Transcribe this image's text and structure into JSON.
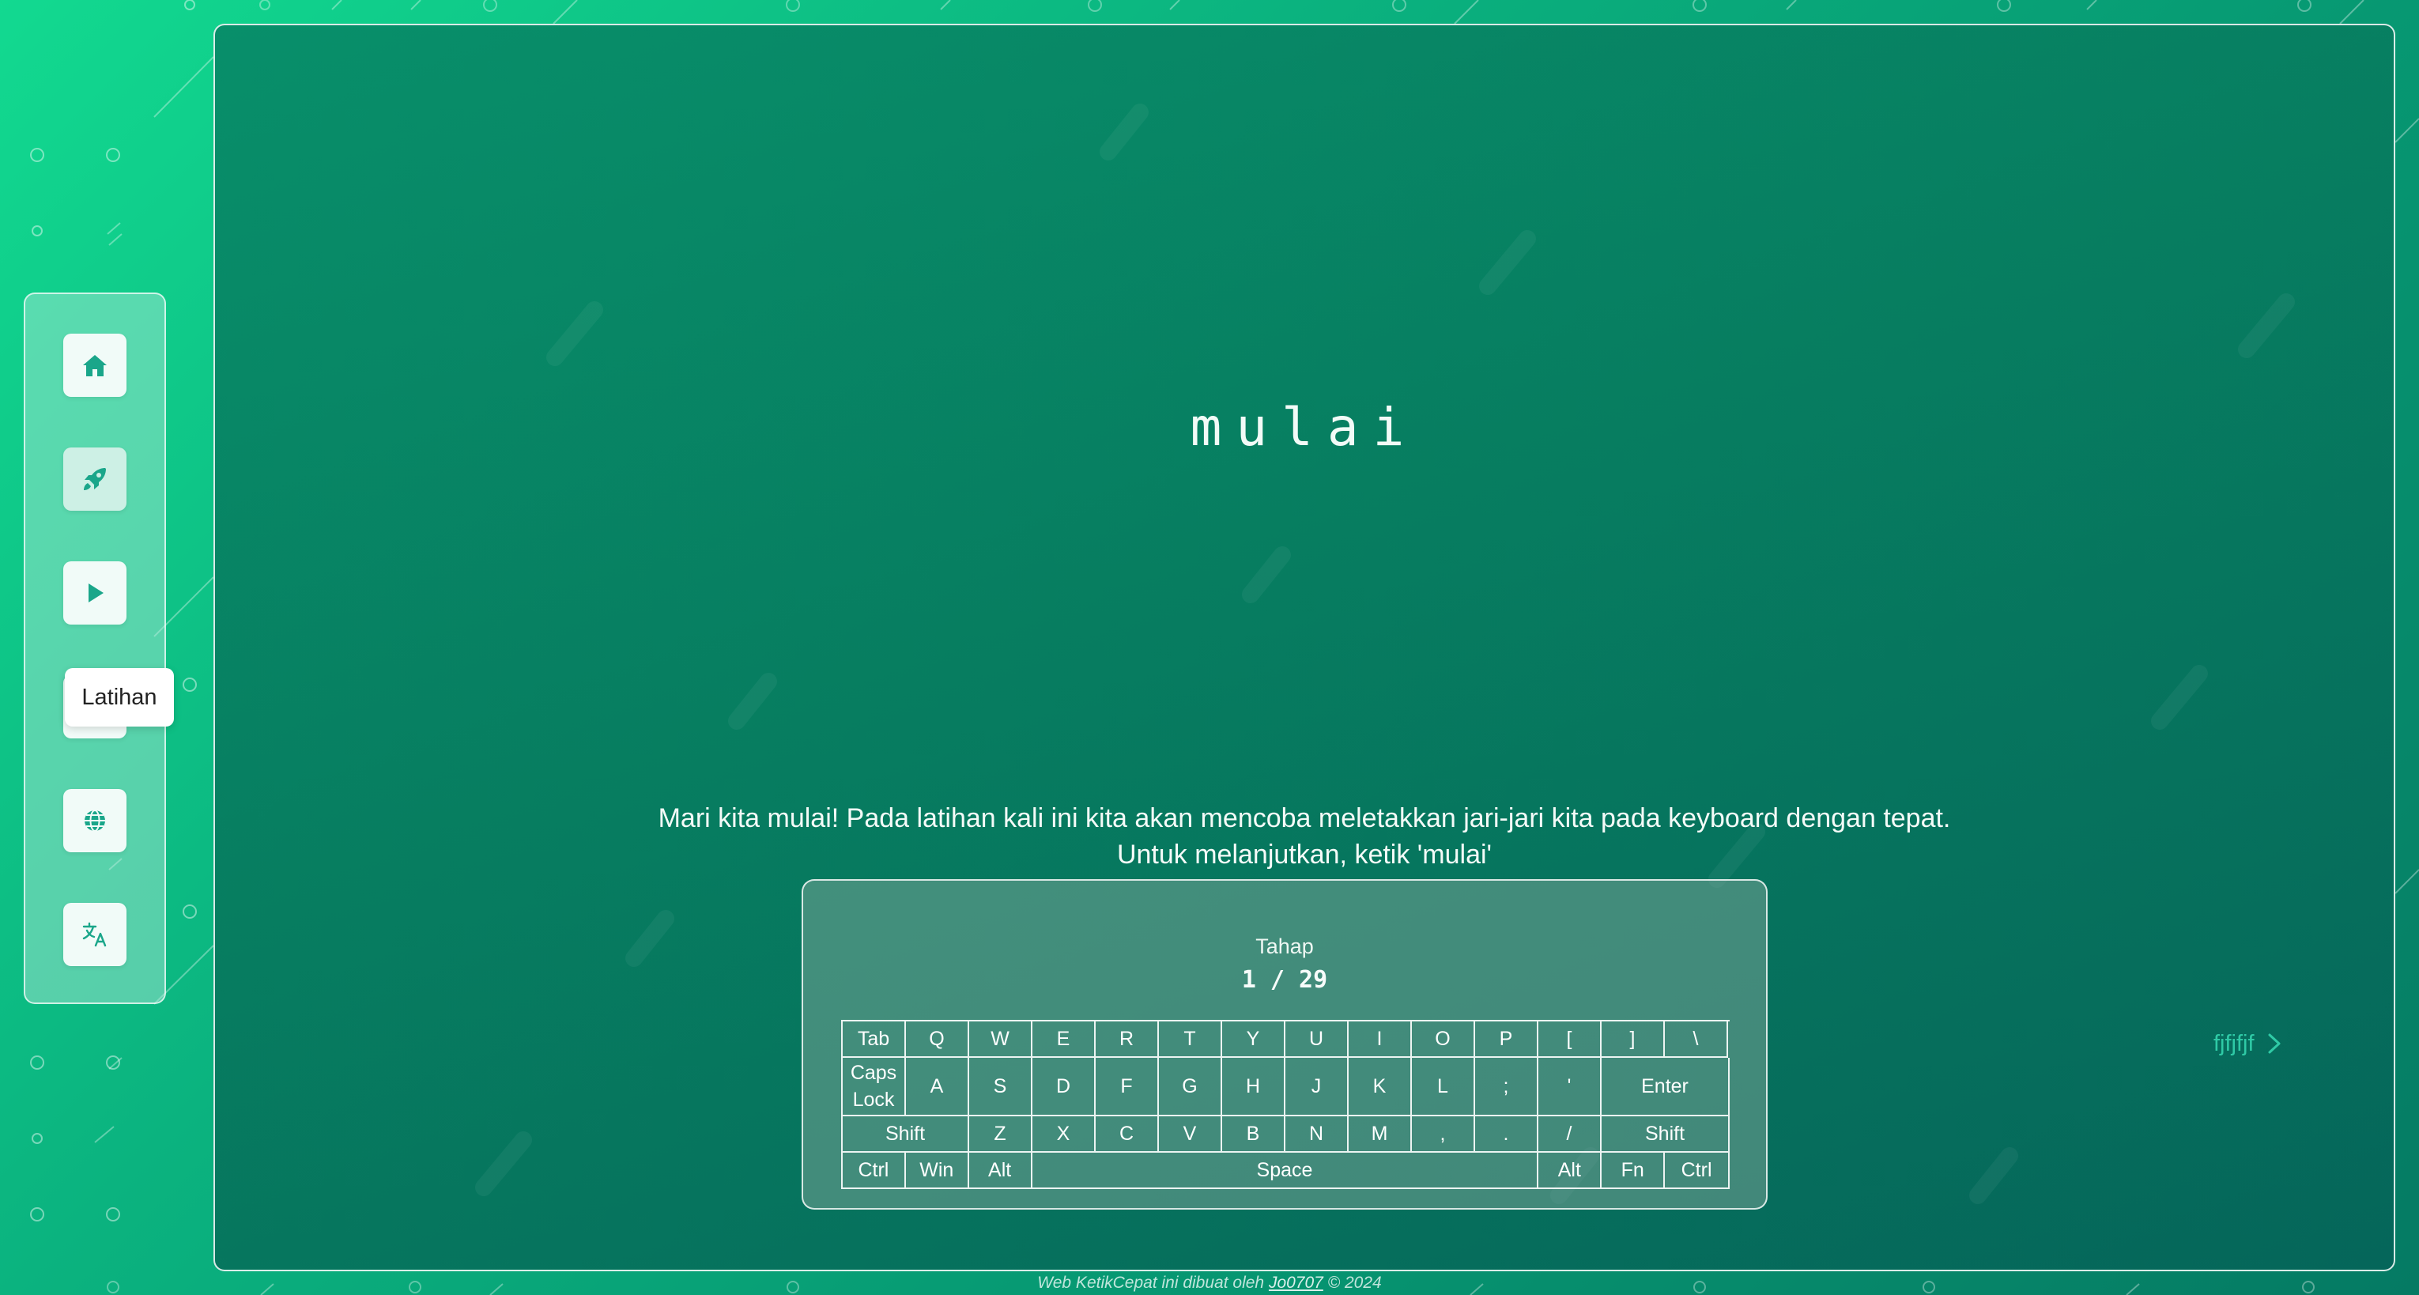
{
  "sidebar": {
    "tooltip": "Latihan",
    "items": [
      {
        "icon": "home-icon",
        "name": "home"
      },
      {
        "icon": "rocket-icon",
        "name": "latihan"
      },
      {
        "icon": "play-icon",
        "name": "play"
      },
      {
        "icon": "menu-icon",
        "name": "menu"
      },
      {
        "icon": "globe-icon",
        "name": "globe"
      },
      {
        "icon": "translate-icon",
        "name": "language"
      }
    ]
  },
  "exercise": {
    "target_word": "mulai",
    "instruction_line1": "Mari kita mulai! Pada latihan kali ini kita akan mencoba meletakkan jari-jari kita pada keyboard dengan tepat.",
    "instruction_line2": "Untuk melanjutkan, ketik 'mulai'"
  },
  "stage": {
    "label": "Tahap",
    "value": "1 / 29"
  },
  "keyboard": {
    "rows": [
      [
        "Tab",
        "Q",
        "W",
        "E",
        "R",
        "T",
        "Y",
        "U",
        "I",
        "O",
        "P",
        "[",
        "]",
        "\\"
      ],
      [
        "Caps\nLock",
        "A",
        "S",
        "D",
        "F",
        "G",
        "H",
        "J",
        "K",
        "L",
        ";",
        "'",
        "Enter"
      ],
      [
        "Shift",
        "Z",
        "X",
        "C",
        "V",
        "B",
        "N",
        "M",
        ",",
        ".",
        "/",
        "Shift"
      ],
      [
        "Ctrl",
        "Win",
        "Alt",
        "Space",
        "Alt",
        "Fn",
        "Ctrl"
      ]
    ]
  },
  "next": {
    "label": "fjfjfjf"
  },
  "footer": {
    "prefix": "Web KetikCepat ini dibuat oleh ",
    "author": "Jo0707",
    "suffix": " © 2024"
  },
  "colors": {
    "bg_light": "#12d990",
    "bg_dark": "#057a63",
    "accent": "#1aa68a",
    "next_link": "#2fcaa6"
  }
}
